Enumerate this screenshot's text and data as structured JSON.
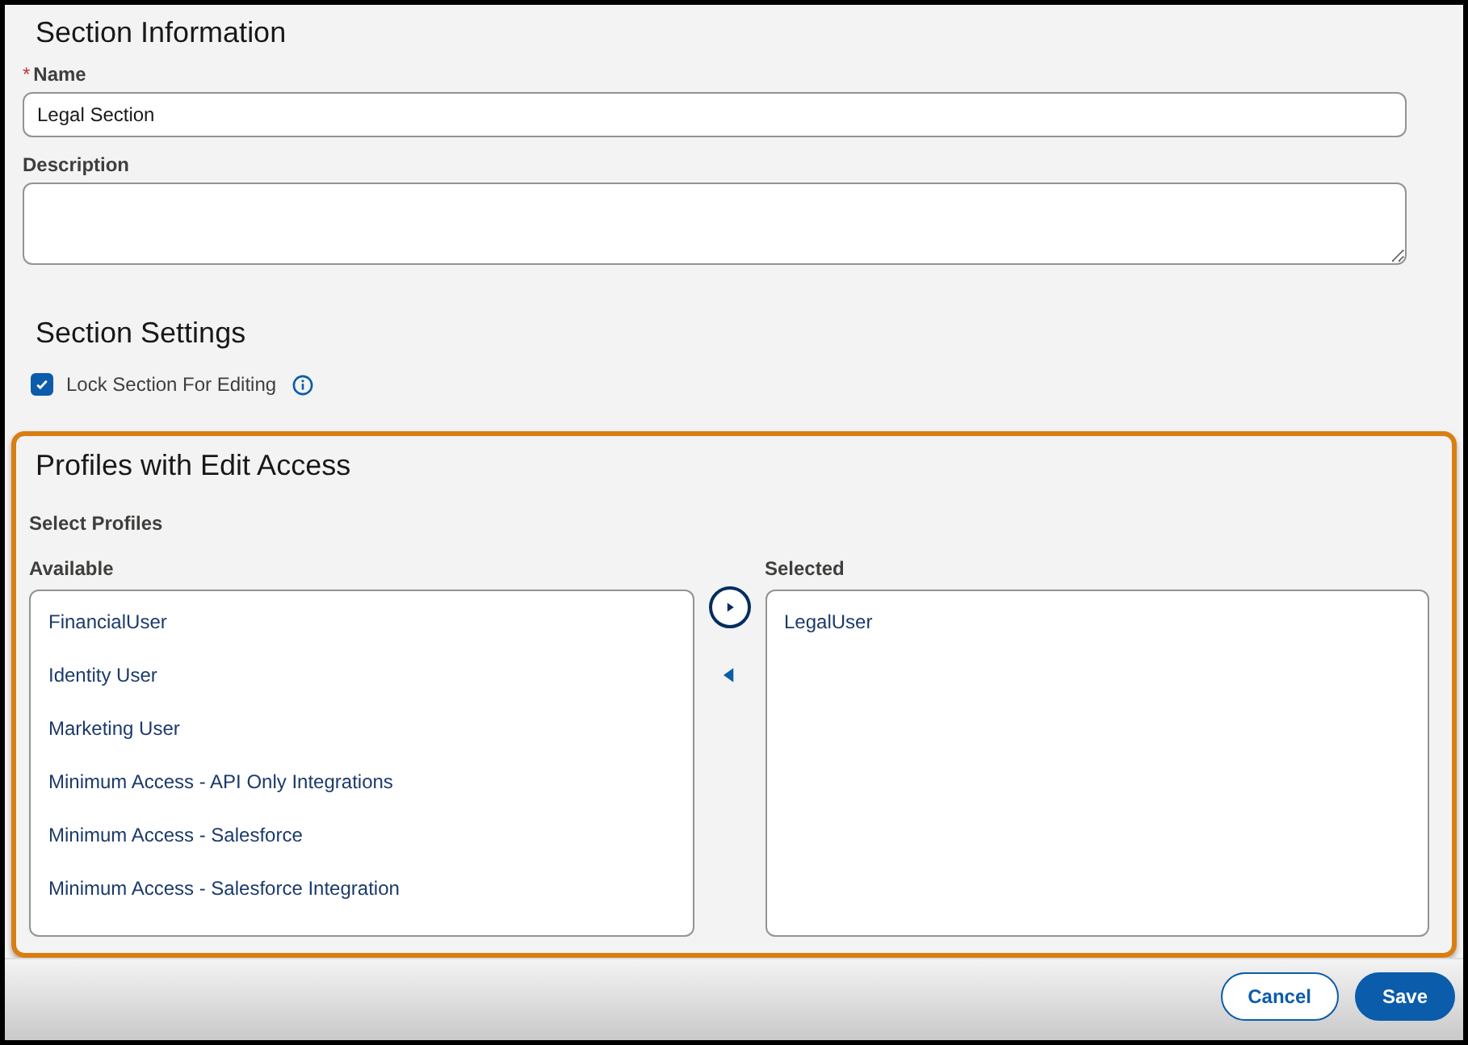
{
  "section_information": {
    "heading": "Section Information",
    "fields": [
      {
        "kind": "input",
        "required_mark": "*",
        "label": "Name",
        "value": "Legal Section"
      },
      {
        "kind": "textarea",
        "label": "Description"
      }
    ]
  },
  "section_settings": {
    "heading": "Section Settings",
    "options": [
      {
        "label": "Lock Section For Editing",
        "checked": true
      }
    ]
  },
  "profiles": {
    "heading": "Profiles with Edit Access",
    "label": "Select Profiles",
    "available": {
      "label": "Available",
      "items": [
        "FinancialUser",
        "Identity User",
        "Marketing User",
        "Minimum Access - API Only Integrations",
        "Minimum Access - Salesforce",
        "Minimum Access - Salesforce Integration"
      ]
    },
    "selected": {
      "label": "Selected",
      "items": [
        "LegalUser"
      ]
    }
  },
  "footer": {
    "buttons": [
      {
        "label": "Cancel",
        "kind": "outline"
      },
      {
        "label": "Save",
        "kind": "brand"
      }
    ]
  }
}
